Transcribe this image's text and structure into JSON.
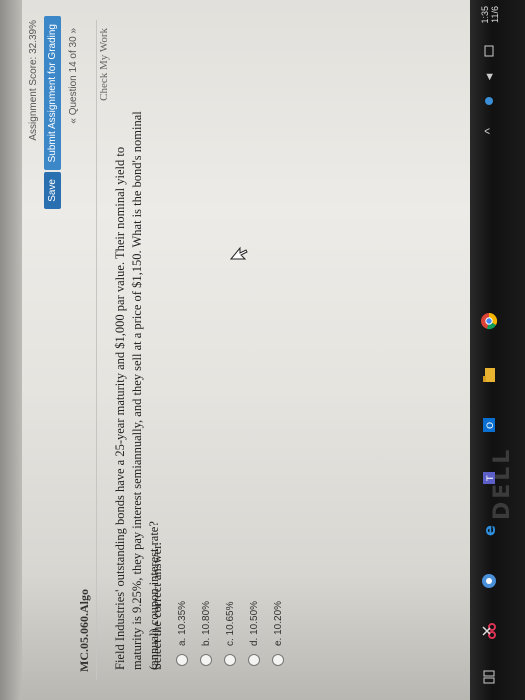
{
  "header": {
    "score_text": "Assignment Score: 32.39%",
    "save_label": "Save",
    "submit_label": "Submit Assignment for Grading",
    "question_nav": "« Question 14 of 30 »"
  },
  "problem": {
    "id": "MC.05.060.Algo",
    "check_label": "Check My Work",
    "text": "Field Industries' outstanding bonds have a 25-year maturity and $1,000 par value. Their nominal yield to maturity is 9.25%, they pay interest semiannually, and they sell at a price of $1,150. What is the bond's nominal (annual) coupon interest rate?",
    "instruction": "Select the correct answer.",
    "options": [
      "a. 10.35%",
      "b. 10.80%",
      "c. 10.65%",
      "d. 10.50%",
      "e. 10.20%"
    ]
  },
  "monitor": {
    "brand": "DELL"
  },
  "taskbar": {
    "icons": [
      "task-view-icon",
      "snip-icon",
      "chrome-alt-icon",
      "edge-icon",
      "teams-icon",
      "outlook-icon",
      "file-explorer-icon",
      "chrome-icon"
    ],
    "clock_time": "1:35",
    "clock_date": "11/6"
  }
}
